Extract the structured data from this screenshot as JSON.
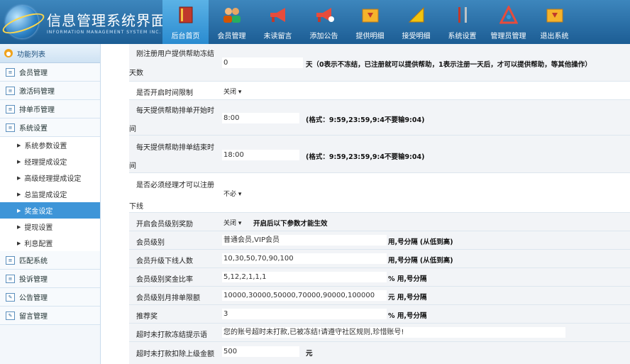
{
  "header": {
    "title": "信息管理系统界面",
    "subtitle": "INFORMATION MANAGEMENT SYSTEM INC.",
    "nav": [
      {
        "label": "后台首页",
        "icon": "book-icon",
        "active": true
      },
      {
        "label": "会员管理",
        "icon": "users-icon"
      },
      {
        "label": "未读留言",
        "icon": "megaphone-icon"
      },
      {
        "label": "添加公告",
        "icon": "megaphone-add-icon"
      },
      {
        "label": "提供明细",
        "icon": "folder-down-icon"
      },
      {
        "label": "接受明细",
        "icon": "ruler-icon"
      },
      {
        "label": "系统设置",
        "icon": "tools-icon"
      },
      {
        "label": "管理员管理",
        "icon": "admin-icon"
      },
      {
        "label": "退出系统",
        "icon": "exit-icon"
      }
    ]
  },
  "sidebar": {
    "title": "功能列表",
    "items": [
      {
        "label": "会员管理"
      },
      {
        "label": "激活码管理"
      },
      {
        "label": "排单币管理"
      },
      {
        "label": "系统设置"
      }
    ],
    "subitems": [
      {
        "label": "系统参数设置"
      },
      {
        "label": "经理提成设定"
      },
      {
        "label": "高级经理提成设定"
      },
      {
        "label": "总监提成设定"
      },
      {
        "label": "奖金设定",
        "active": true
      },
      {
        "label": "提现设置"
      },
      {
        "label": "利息配置"
      }
    ],
    "items2": [
      {
        "label": "匹配系统"
      },
      {
        "label": "投诉管理"
      },
      {
        "label": "公告管理"
      },
      {
        "label": "留言管理"
      }
    ]
  },
  "form": {
    "freeze_label_a": "刚注册用户提供帮助冻结",
    "freeze_label_b": "天数",
    "freeze_value": "0",
    "freeze_note": "天（0表示不冻结，已注册就可以提供帮助，1表示注册一天后，才可以提供帮助，等其他操作）",
    "time_limit_label": "是否开启时间限制",
    "time_limit_value": "关闭",
    "start_label_a": "每天提供帮助排单开始时",
    "start_label_b": "间",
    "start_value": "8:00",
    "start_note": "(格式：9:59,23:59,9:4不要输9:04)",
    "end_label_a": "每天提供帮助排单结束时",
    "end_label_b": "间",
    "end_value": "18:00",
    "end_note": "(格式：9:59,23:59,9:4不要输9:04)",
    "manager_reg_label_a": "是否必须经理才可以注册",
    "manager_reg_label_b": "下线",
    "manager_reg_value": "不必",
    "level_reward_label": "开启会员级别奖励",
    "level_reward_value": "关闭",
    "level_reward_note": "开启后以下参数才能生效",
    "member_level_label": "会员级别",
    "member_level_value": "普通会员,VIP会员",
    "member_level_note": "用,号分隔 (从低到高)",
    "upgrade_label": "会员升级下线人数",
    "upgrade_value": "10,30,50,70,90,100",
    "upgrade_note": "用,号分隔 (从低到高)",
    "bonus_rate_label": "会员级别奖金比率",
    "bonus_rate_value": "5,12,2,1,1,1",
    "bonus_rate_note": "% 用,号分隔",
    "monthly_limit_label": "会员级别月排单限额",
    "monthly_limit_value": "10000,30000,50000,70000,90000,100000",
    "monthly_limit_note": "元 用,号分隔",
    "referral_label": "推荐奖",
    "referral_value": "3",
    "referral_note": "% 用,号分隔",
    "timeout_msg_label": "超时未打款冻结提示语",
    "timeout_msg_value": "您的账号超时未打款,已被冻结!请遵守社区规则,珍惜账号!",
    "timeout_deduct_label": "超时未打款扣除上级金额",
    "timeout_deduct_value": "500",
    "timeout_deduct_note": "元"
  }
}
